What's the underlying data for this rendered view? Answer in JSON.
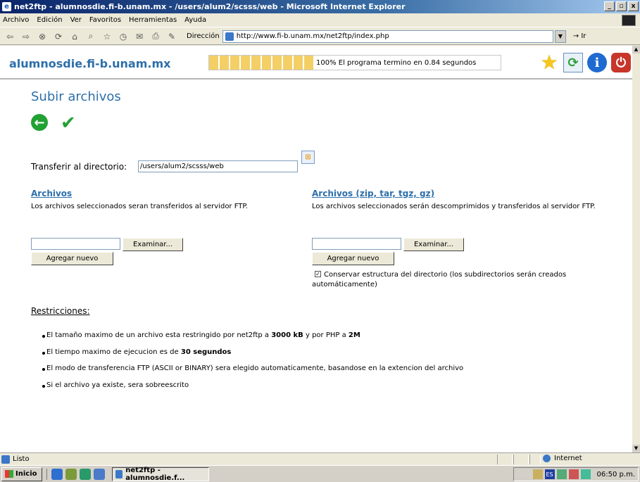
{
  "window": {
    "title": "net2ftp - alumnosdie.fi-b.unam.mx - /users/alum2/scsss/web - Microsoft Internet Explorer"
  },
  "menu": [
    "Archivo",
    "Edición",
    "Ver",
    "Favoritos",
    "Herramientas",
    "Ayuda"
  ],
  "address_bar": {
    "label": "Dirección",
    "url": "http://www.fi-b.unam.mx/net2ftp/index.php",
    "go_label": "Ir"
  },
  "header": {
    "host": "alumnosdie.fi-b.unam.mx",
    "progress_text": "100% El programa termino en 0.84 segundos",
    "progress_value": 1.0,
    "icons": [
      "star-icon",
      "refresh-icon",
      "info-icon",
      "power-icon"
    ]
  },
  "page": {
    "title": "Subir archivos",
    "directory_label": "Transferir al directorio:",
    "directory_value": "/users/alum2/scsss/web"
  },
  "columns": {
    "files": {
      "title": "Archivos",
      "description": "Los archivos seleccionados seran transferidos al servidor FTP.",
      "browse_label": "Examinar...",
      "add_label": "Agregar nuevo"
    },
    "archives": {
      "title": "Archivos (zip, tar, tgz, gz)",
      "description": "Los archivos seleccionados serán descomprimidos y transferidos al servidor FTP.",
      "browse_label": "Examinar...",
      "add_label": "Agregar nuevo",
      "keep_structure_label": "Conservar estructura del directorio (los subdirectorios serán creados automáticamente)",
      "keep_structure_checked": true
    }
  },
  "restrictions": {
    "title": "Restricciones:",
    "items": [
      {
        "pre": "El tamaño maximo de un archivo esta restringido por net2ftp a ",
        "b1": "3000 kB",
        "mid": " y por PHP a ",
        "b2": "2M",
        "post": ""
      },
      {
        "pre": "El tiempo maximo de ejecucion es de ",
        "b1": "30 segundos",
        "mid": "",
        "b2": "",
        "post": ""
      },
      {
        "pre": "El modo de transferencia FTP (ASCII or BINARY) sera elegido automaticamente, basandose en la extencion del archivo",
        "b1": "",
        "mid": "",
        "b2": "",
        "post": ""
      },
      {
        "pre": "Si el archivo ya existe, sera sobreescrito",
        "b1": "",
        "mid": "",
        "b2": "",
        "post": ""
      }
    ]
  },
  "status": {
    "text": "Listo",
    "zone": "Internet"
  },
  "taskbar": {
    "start_label": "Inicio",
    "task_label": "net2ftp - alumnosdie.f...",
    "clock": "06:50 p.m.",
    "lang": "ES"
  }
}
